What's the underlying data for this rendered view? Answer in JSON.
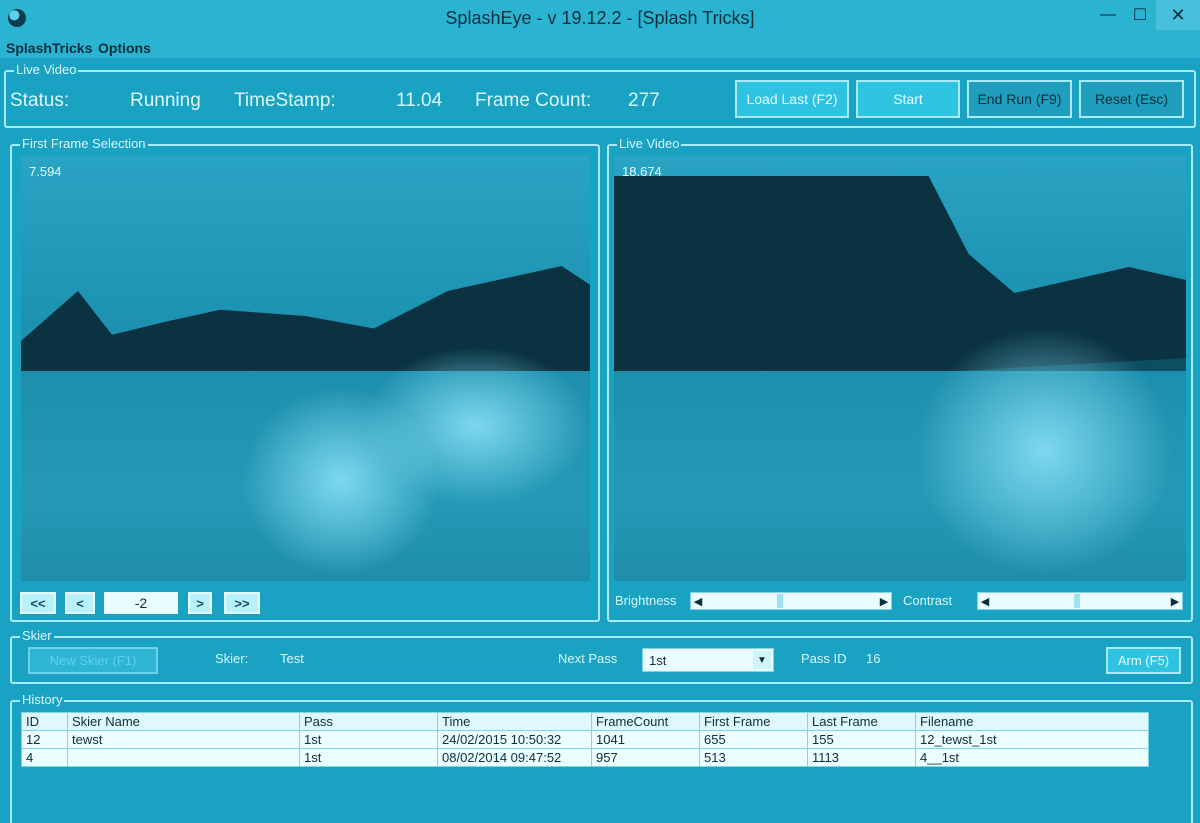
{
  "window": {
    "title": "SplashEye - v 19.12.2 - [Splash Tricks]",
    "minimize": "—",
    "maximize": "☐",
    "close": "✕"
  },
  "menu": [
    "SplashTricks",
    "Options"
  ],
  "live_group": {
    "label": "Live Video",
    "status_label": "Status:",
    "status_value": "Running",
    "timestamp_label": "TimeStamp:",
    "timestamp_value": "11.04",
    "framecount_label": "Frame Count:",
    "framecount_value": "277",
    "buttons": {
      "load_last": "Load Last (F2)",
      "start": "Start",
      "end_run": "End Run (F9)",
      "reset": "Reset (Esc)"
    }
  },
  "first_frame": {
    "label": "First Frame Selection",
    "timestamp": "7.594",
    "nav": {
      "first": "<<",
      "prev": "<",
      "frame_offset": "-2",
      "next": ">",
      "last": ">>"
    }
  },
  "live_video": {
    "label": "Live Video",
    "timestamp": "18.674",
    "brightness_label": "Brightness",
    "contrast_label": "Contrast"
  },
  "skier_group": {
    "label": "Skier",
    "new_skier": "New Skier (F1)",
    "skier_label": "Skier:",
    "skier_value": "Test",
    "next_pass_label": "Next Pass",
    "next_pass_value": "1st",
    "pass_id_label": "Pass ID",
    "pass_id_value": "16",
    "arm": "Arm (F5)"
  },
  "history": {
    "label": "History",
    "columns": [
      "ID",
      "Skier Name",
      "Pass",
      "Time",
      "FrameCount",
      "First Frame",
      "Last Frame",
      "Filename"
    ],
    "rows": [
      [
        "12",
        "tewst",
        "1st",
        "24/02/2015 10:50:32",
        "1041",
        "655",
        "155",
        "12_tewst_1st"
      ],
      [
        "4",
        "",
        "1st",
        "08/02/2014 09:47:52",
        "957",
        "513",
        "1113",
        "4__1st"
      ]
    ]
  }
}
